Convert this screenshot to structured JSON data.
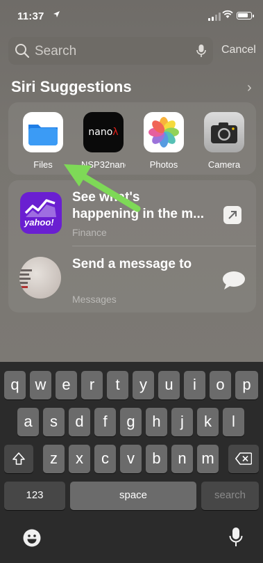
{
  "status_bar": {
    "time": "11:37"
  },
  "search": {
    "placeholder": "Search",
    "cancel_label": "Cancel"
  },
  "suggestions": {
    "title": "Siri Suggestions",
    "apps": [
      {
        "label": "Files",
        "icon": "files-app-icon"
      },
      {
        "label": "NSP32nanoL...",
        "icon": "nano-app-icon",
        "icon_text": "nano",
        "icon_text_accent": "λ"
      },
      {
        "label": "Photos",
        "icon": "photos-app-icon"
      },
      {
        "label": "Camera",
        "icon": "camera-app-icon"
      }
    ]
  },
  "results": [
    {
      "line1": "See what's",
      "line2": "happening in the m...",
      "source": "Finance",
      "icon_text": "yahoo!"
    },
    {
      "line1": "Send a message to",
      "source": "Messages"
    }
  ],
  "keyboard": {
    "row1": [
      "q",
      "w",
      "e",
      "r",
      "t",
      "y",
      "u",
      "i",
      "o",
      "p"
    ],
    "row2": [
      "a",
      "s",
      "d",
      "f",
      "g",
      "h",
      "j",
      "k",
      "l"
    ],
    "row3": [
      "z",
      "x",
      "c",
      "v",
      "b",
      "n",
      "m"
    ],
    "numbers_label": "123",
    "space_label": "space",
    "search_label": "search"
  },
  "colors": {
    "annotation_arrow": "#7ed957",
    "yahoo_purple": "#6a1fd1"
  }
}
